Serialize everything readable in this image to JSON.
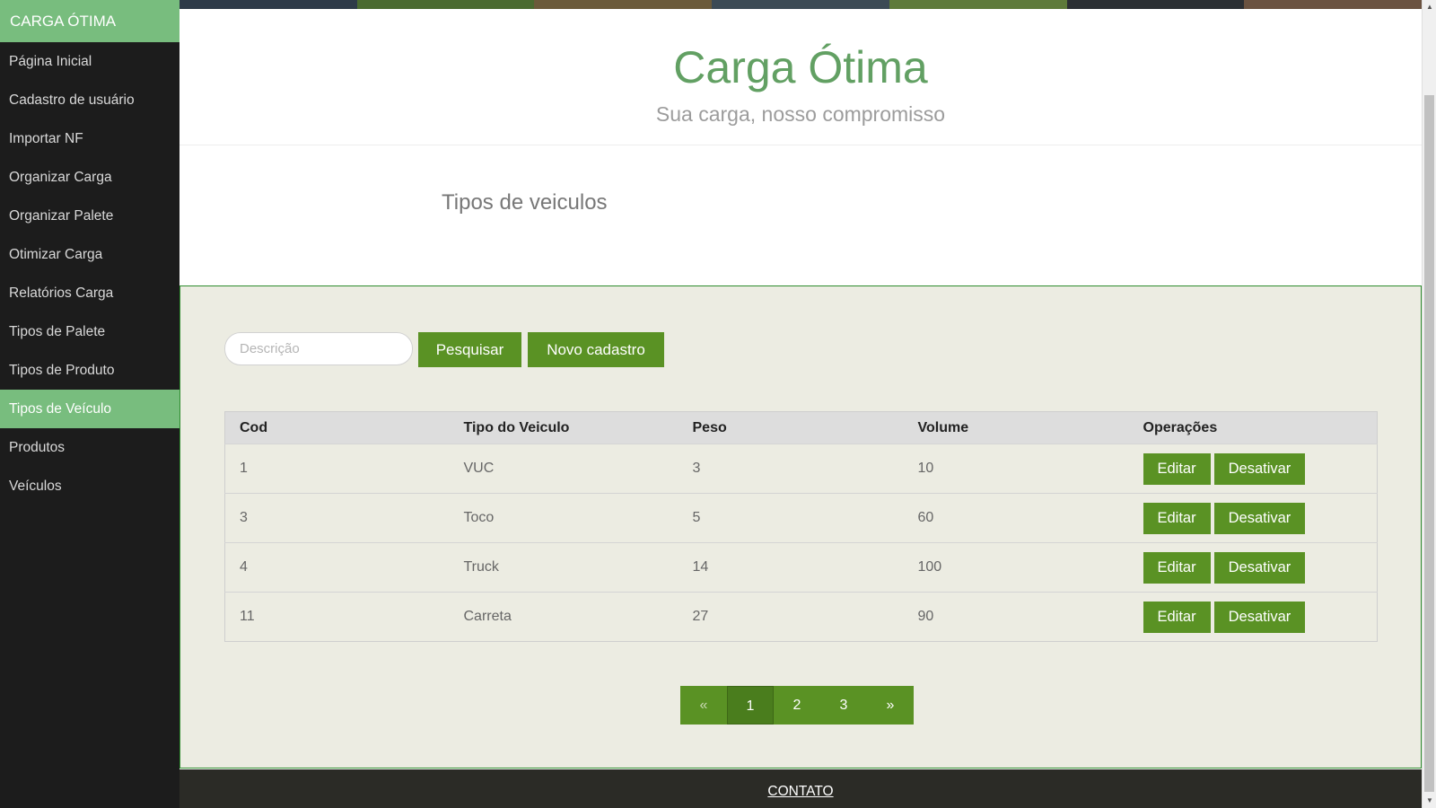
{
  "sidebar": {
    "brand": "CARGA ÓTIMA",
    "items": [
      {
        "label": "Página Inicial"
      },
      {
        "label": "Cadastro de usuário"
      },
      {
        "label": "Importar NF"
      },
      {
        "label": "Organizar Carga"
      },
      {
        "label": "Organizar Palete"
      },
      {
        "label": "Otimizar Carga"
      },
      {
        "label": "Relatórios Carga"
      },
      {
        "label": "Tipos de Palete"
      },
      {
        "label": "Tipos de Produto"
      },
      {
        "label": "Tipos de Veículo"
      },
      {
        "label": "Produtos"
      },
      {
        "label": "Veículos"
      }
    ],
    "active_index": 9
  },
  "header": {
    "title": "Carga Ótima",
    "subtitle": "Sua carga, nosso compromisso"
  },
  "page": {
    "title": "Tipos de veiculos"
  },
  "search": {
    "placeholder": "Descrição",
    "value": "",
    "search_label": "Pesquisar",
    "new_label": "Novo cadastro"
  },
  "table": {
    "headers": [
      "Cod",
      "Tipo do Veiculo",
      "Peso",
      "Volume",
      "Operações"
    ],
    "rows": [
      {
        "cod": "1",
        "tipo": "VUC",
        "peso": "3",
        "volume": "10"
      },
      {
        "cod": "3",
        "tipo": "Toco",
        "peso": "5",
        "volume": "60"
      },
      {
        "cod": "4",
        "tipo": "Truck",
        "peso": "14",
        "volume": "100"
      },
      {
        "cod": "11",
        "tipo": "Carreta",
        "peso": "27",
        "volume": "90"
      }
    ],
    "edit_label": "Editar",
    "disable_label": "Desativar"
  },
  "pagination": {
    "prev": "«",
    "pages": [
      "1",
      "2",
      "3"
    ],
    "current": "1",
    "next": "»"
  },
  "footer": {
    "contact": "CONTATO"
  },
  "colors": {
    "accent_green": "#78bd7e",
    "button_green": "#5a9224",
    "title_green": "#62a063",
    "sidebar_bg": "#1c1c1c",
    "content_bg": "#ecece2",
    "footer_bg": "#2b2b26"
  }
}
